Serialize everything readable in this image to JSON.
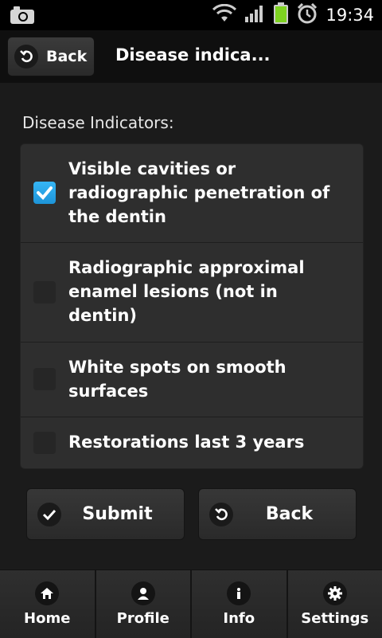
{
  "status_bar": {
    "time": "19:34",
    "icons": [
      "camera-icon",
      "wifi-icon",
      "signal-icon",
      "battery-icon",
      "alarm-icon"
    ]
  },
  "header": {
    "back_label": "Back",
    "title": "Disease indica..."
  },
  "section": {
    "label": "Disease Indicators:"
  },
  "indicators": [
    {
      "label": "Visible cavities or radiographic penetration of the dentin",
      "checked": true
    },
    {
      "label": "Radiographic approximal enamel lesions (not in dentin)",
      "checked": false
    },
    {
      "label": "White spots on smooth surfaces",
      "checked": false
    },
    {
      "label": "Restorations last 3 years",
      "checked": false
    }
  ],
  "actions": {
    "submit_label": "Submit",
    "back_label": "Back"
  },
  "nav": [
    {
      "label": "Home",
      "icon": "home-icon"
    },
    {
      "label": "Profile",
      "icon": "profile-icon"
    },
    {
      "label": "Info",
      "icon": "info-icon"
    },
    {
      "label": "Settings",
      "icon": "settings-icon"
    }
  ],
  "colors": {
    "accent": "#2aa7ea",
    "battery": "#7ed321",
    "background": "#1b1b1b"
  }
}
